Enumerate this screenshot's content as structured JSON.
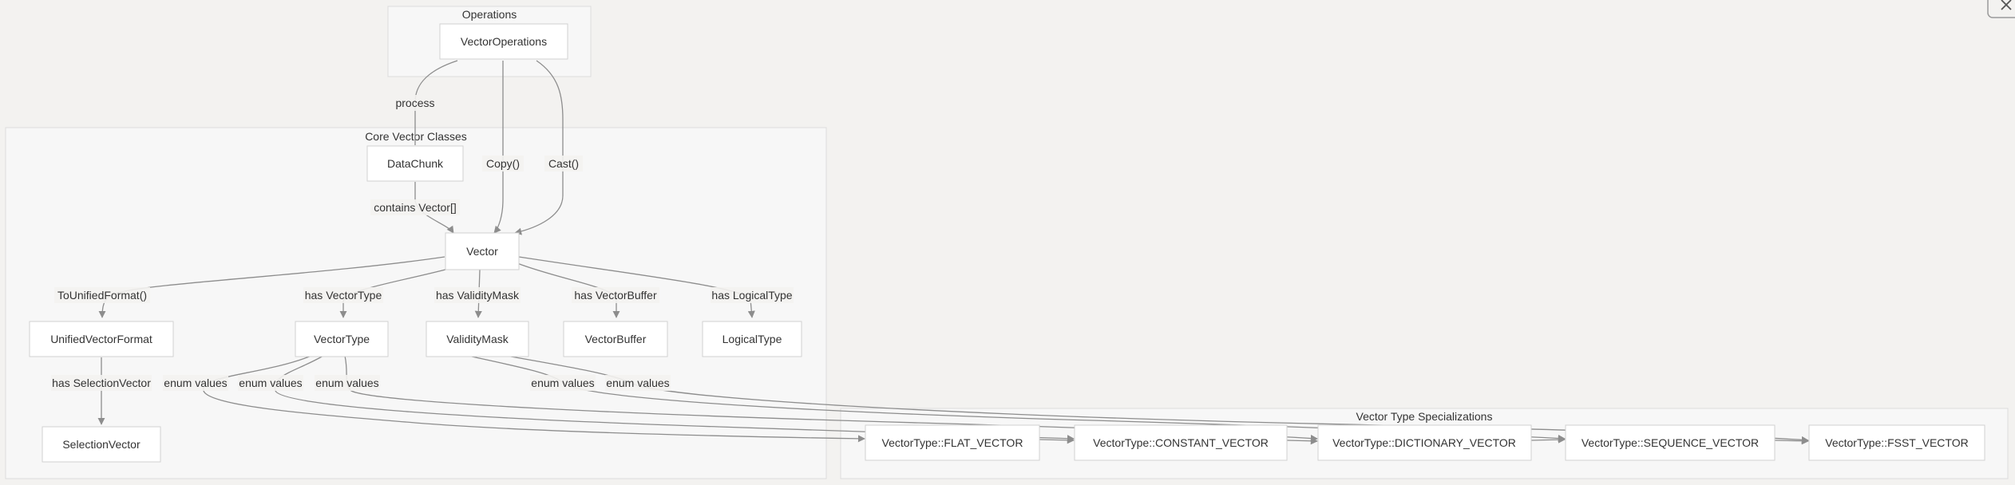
{
  "clusters": {
    "operations": "Operations",
    "core": "Core Vector Classes",
    "specializations": "Vector Type Specializations"
  },
  "nodes": {
    "vector_operations": "VectorOperations",
    "data_chunk": "DataChunk",
    "vector": "Vector",
    "unified_vector_format": "UnifiedVectorFormat",
    "vector_type": "VectorType",
    "validity_mask": "ValidityMask",
    "vector_buffer": "VectorBuffer",
    "logical_type": "LogicalType",
    "selection_vector": "SelectionVector",
    "flat_vector": "VectorType::FLAT_VECTOR",
    "constant_vector": "VectorType::CONSTANT_VECTOR",
    "dictionary_vector": "VectorType::DICTIONARY_VECTOR",
    "sequence_vector": "VectorType::SEQUENCE_VECTOR",
    "fsst_vector": "VectorType::FSST_VECTOR"
  },
  "edge_labels": {
    "process": "process",
    "copy": "Copy()",
    "cast": "Cast()",
    "contains": "contains Vector[]",
    "to_unified": "ToUnifiedFormat()",
    "has_vector_type": "has VectorType",
    "has_validity_mask": "has ValidityMask",
    "has_vector_buffer": "has VectorBuffer",
    "has_logical_type": "has LogicalType",
    "has_selection_vector": "has SelectionVector",
    "enum_1": "enum values",
    "enum_2": "enum values",
    "enum_3": "enum values",
    "enum_4": "enum values",
    "enum_5": "enum values"
  }
}
